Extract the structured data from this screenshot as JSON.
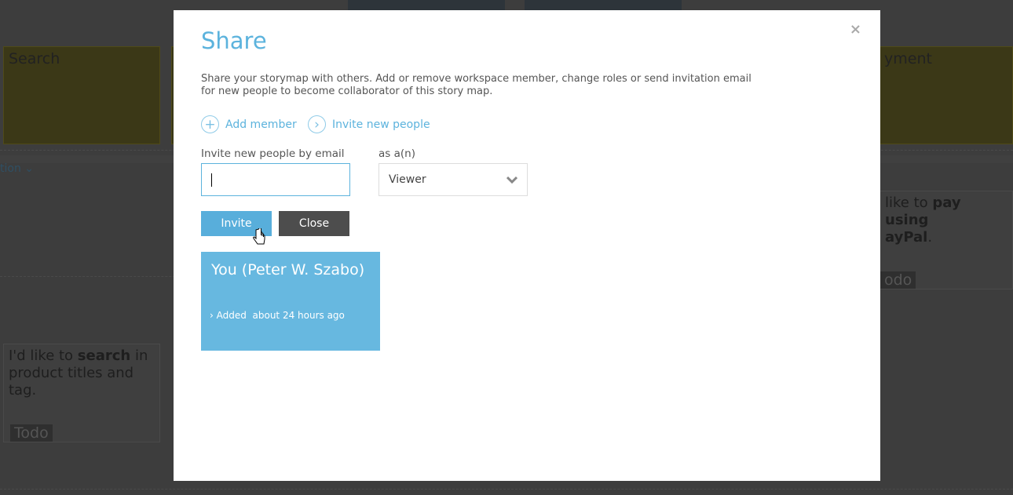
{
  "background": {
    "cards": [
      "Search",
      "yment"
    ],
    "filter_label": "tion",
    "stories": [
      {
        "pre": "I'd like to ",
        "bold": "search",
        "post": " in product titles and tag.",
        "status": "Todo"
      },
      {
        "pre": " like to ",
        "bold": "pay using",
        "line2_bold": "ayPal",
        "post": ".",
        "status": "odo"
      }
    ]
  },
  "modal": {
    "title": "Share",
    "close_icon": "×",
    "description": "Share your storymap with others. Add or remove workspace member, change roles or send invitation email for new people to become collaborator of this story map.",
    "add_member": "Add member",
    "invite_new_people": "Invite new people",
    "email_label": "Invite new people by email",
    "email_value": "",
    "role_label": "as a(n)",
    "role_value": "Viewer",
    "invite_button": "Invite",
    "close_button": "Close",
    "member": {
      "name": "You (Peter W. Szabo)",
      "added_label": "Added",
      "added_time": "about 24 hours ago"
    }
  },
  "colors": {
    "accent": "#5cb3dd",
    "member_card": "#67b8e0",
    "close_button": "#4d4d4d"
  }
}
